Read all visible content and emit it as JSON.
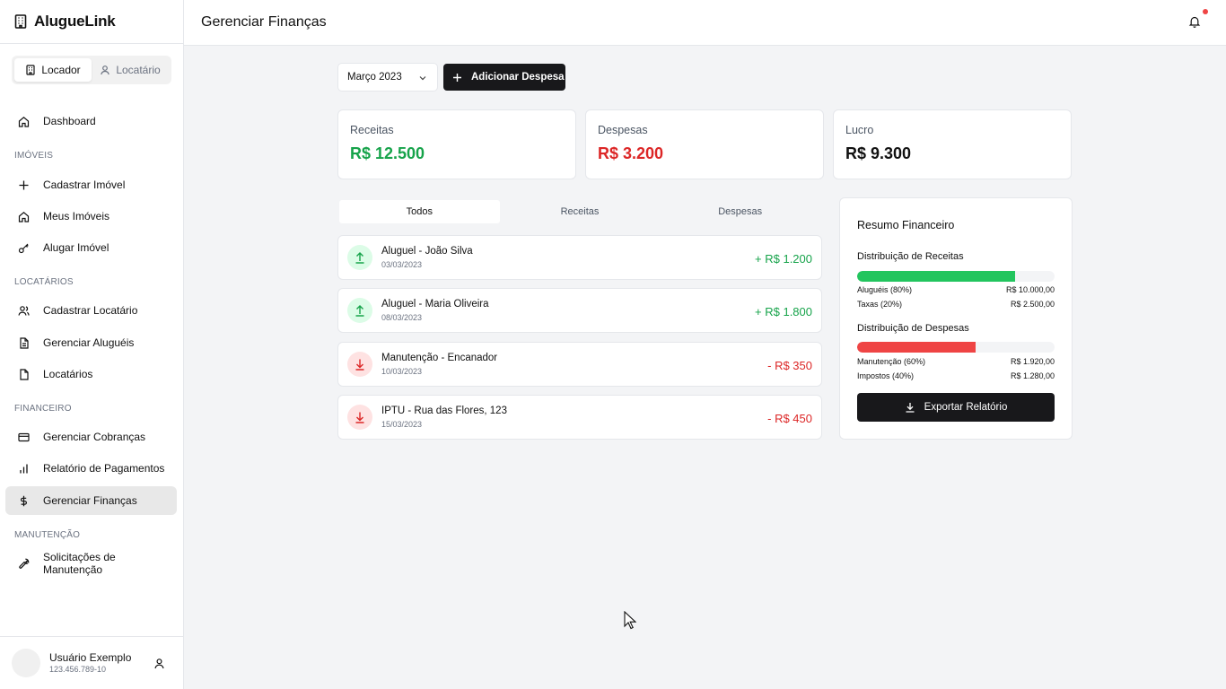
{
  "app": {
    "name": "AlugueLink"
  },
  "roles": {
    "landlord": "Locador",
    "tenant": "Locatário"
  },
  "nav": {
    "dashboard": "Dashboard",
    "sections": {
      "imoveis": "IMÓVEIS",
      "locatarios": "LOCATÁRIOS",
      "financeiro": "FINANCEIRO",
      "manutencao": "MANUTENÇÃO"
    },
    "items": {
      "cadastrar_imovel": "Cadastrar Imóvel",
      "meus_imoveis": "Meus Imóveis",
      "alugar_imovel": "Alugar Imóvel",
      "cadastrar_locatario": "Cadastrar Locatário",
      "gerenciar_alugueis": "Gerenciar Aluguéis",
      "locatarios": "Locatários",
      "gerenciar_cobrancas": "Gerenciar Cobranças",
      "relatorio_pagamentos": "Relatório de Pagamentos",
      "gerenciar_financas": "Gerenciar Finanças",
      "solicitacoes_manutencao": "Solicitações de Manutenção"
    }
  },
  "user": {
    "name": "Usuário Exemplo",
    "id": "123.456.789-10"
  },
  "header": {
    "title": "Gerenciar Finanças"
  },
  "toolbar": {
    "month": "Março 2023",
    "add_expense": "Adicionar Despesa"
  },
  "stats": {
    "receitas": {
      "label": "Receitas",
      "value": "R$ 12.500"
    },
    "despesas": {
      "label": "Despesas",
      "value": "R$ 3.200"
    },
    "lucro": {
      "label": "Lucro",
      "value": "R$ 9.300"
    }
  },
  "tabs": {
    "todos": "Todos",
    "receitas": "Receitas",
    "despesas": "Despesas"
  },
  "transactions": [
    {
      "title": "Aluguel - João Silva",
      "date": "03/03/2023",
      "amount": "+ R$ 1.200",
      "type": "in"
    },
    {
      "title": "Aluguel - Maria Oliveira",
      "date": "08/03/2023",
      "amount": "+ R$ 1.800",
      "type": "in"
    },
    {
      "title": "Manutenção - Encanador",
      "date": "10/03/2023",
      "amount": "- R$ 350",
      "type": "out"
    },
    {
      "title": "IPTU - Rua das Flores, 123",
      "date": "15/03/2023",
      "amount": "- R$ 450",
      "type": "out"
    }
  ],
  "summary": {
    "title": "Resumo Financeiro",
    "income": {
      "title": "Distribuição de Receitas",
      "fill_percent": 80,
      "color": "#22c55e",
      "rows": [
        {
          "label": "Aluguéis (80%)",
          "value": "R$ 10.000,00"
        },
        {
          "label": "Taxas (20%)",
          "value": "R$ 2.500,00"
        }
      ]
    },
    "expense": {
      "title": "Distribuição de Despesas",
      "fill_percent": 60,
      "color": "#ef4444",
      "rows": [
        {
          "label": "Manutenção (60%)",
          "value": "R$ 1.920,00"
        },
        {
          "label": "Impostos (40%)",
          "value": "R$ 1.280,00"
        }
      ]
    },
    "export": "Exportar Relatório"
  },
  "icons": {
    "logo": "building-icon",
    "notification": "bell-icon",
    "income": "arrow-up-icon",
    "expense": "arrow-down-icon"
  }
}
